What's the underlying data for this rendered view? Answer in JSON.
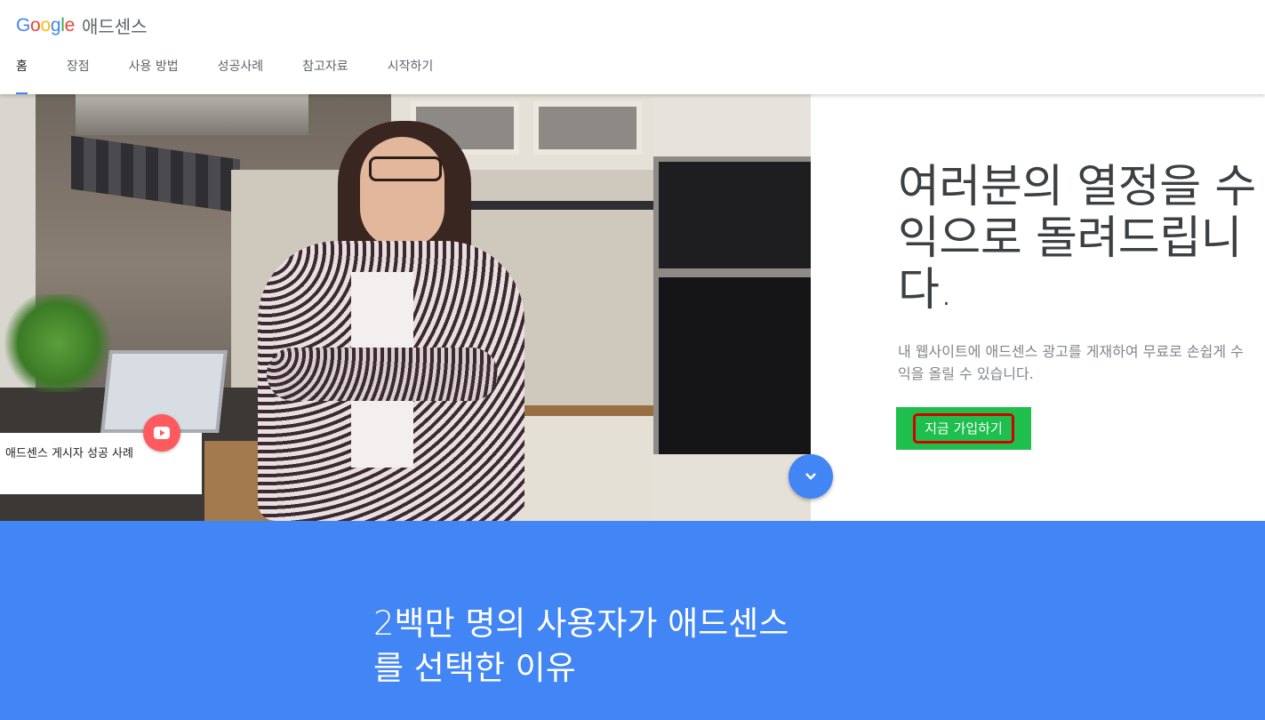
{
  "header": {
    "logo_letters": [
      {
        "ch": "G",
        "color": "#4285f4"
      },
      {
        "ch": "o",
        "color": "#ea4335"
      },
      {
        "ch": "o",
        "color": "#fbbc05"
      },
      {
        "ch": "g",
        "color": "#4285f4"
      },
      {
        "ch": "l",
        "color": "#34a853"
      },
      {
        "ch": "e",
        "color": "#ea4335"
      }
    ],
    "product_name": "애드센스"
  },
  "nav": {
    "items": [
      {
        "label": "홈",
        "active": true
      },
      {
        "label": "장점",
        "active": false
      },
      {
        "label": "사용 방법",
        "active": false
      },
      {
        "label": "성공사례",
        "active": false
      },
      {
        "label": "참고자료",
        "active": false
      },
      {
        "label": "시작하기",
        "active": false
      }
    ]
  },
  "hero": {
    "video_card_text": "애드센스 게시자 성공 사례",
    "play_icon": "youtube-play-icon",
    "scroll_icon": "chevron-down-icon",
    "title": "여러분의 열정을 수익으로 돌려드립니다.",
    "description": "내 웹사이트에 애드센스 광고를 게재하여 무료로 손쉽게 수익을 올릴 수 있습니다.",
    "signup_label": "지금 가입하기"
  },
  "section2": {
    "title": "2백만 명의 사용자가 애드센스를 선택한 이유"
  },
  "colors": {
    "accent_blue": "#4285f4",
    "signup_green": "#1fbf4e",
    "highlight_red": "#d40000",
    "play_red": "#ff5a5f"
  }
}
